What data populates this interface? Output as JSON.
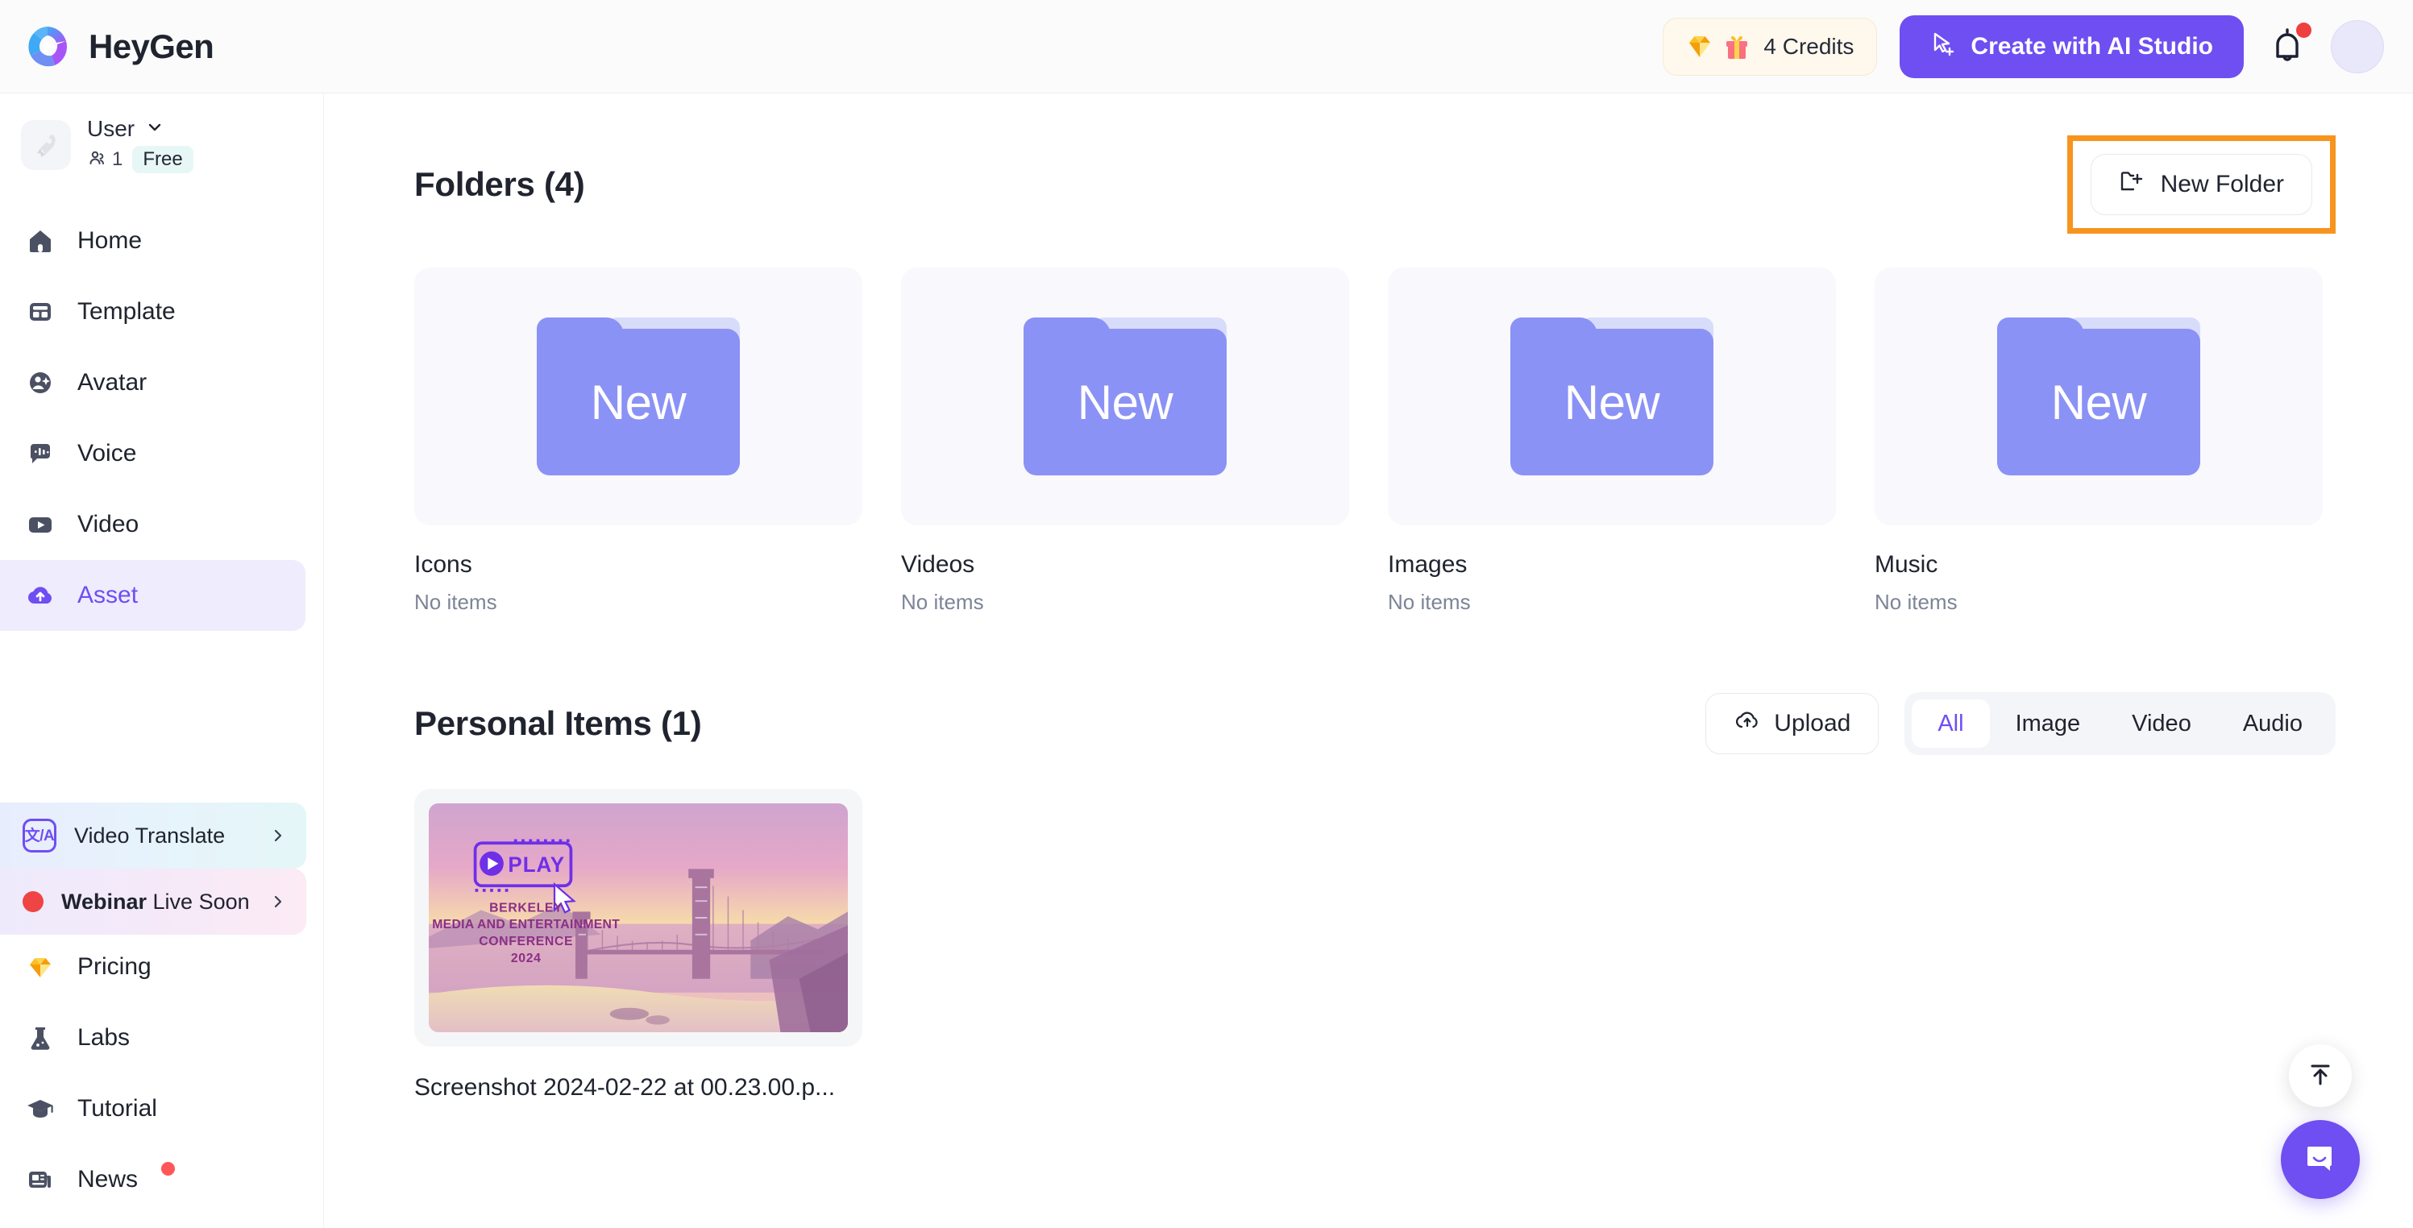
{
  "brand": {
    "name": "HeyGen",
    "logo_icon": "heygen-logo-icon"
  },
  "topbar": {
    "credits": {
      "label": "4 Credits",
      "gem_icon": "gem-icon",
      "gift_icon": "gift-icon"
    },
    "cta": {
      "label": "Create with AI Studio",
      "icon": "cursor-plus-icon"
    },
    "bell_icon": "bell-icon",
    "avatar_icon": "avatar-icon"
  },
  "sidebar": {
    "workspace": {
      "name": "User",
      "seats": "1",
      "plan": "Free",
      "thumb_icon": "rocket-icon",
      "chevron_icon": "chevron-down-icon",
      "members_icon": "members-icon"
    },
    "items": [
      {
        "label": "Home",
        "icon": "home-icon",
        "active": false
      },
      {
        "label": "Template",
        "icon": "template-icon",
        "active": false
      },
      {
        "label": "Avatar",
        "icon": "avatar-face-icon",
        "active": false
      },
      {
        "label": "Voice",
        "icon": "voice-icon",
        "active": false
      },
      {
        "label": "Video",
        "icon": "video-icon",
        "active": false
      },
      {
        "label": "Asset",
        "icon": "asset-cloud-icon",
        "active": true
      }
    ],
    "promos": [
      {
        "label": "Video Translate",
        "badge": "文/A",
        "icon": "translate-badge-icon",
        "chevron": "chevron-right-icon"
      },
      {
        "label_bold": "Webinar",
        "label_rest": " Live Soon",
        "icon": "live-dot-icon",
        "chevron": "chevron-right-icon"
      }
    ],
    "bottom_items": [
      {
        "label": "Pricing",
        "icon": "gem-icon",
        "dot": false
      },
      {
        "label": "Labs",
        "icon": "flask-icon",
        "dot": false
      },
      {
        "label": "Tutorial",
        "icon": "graduation-cap-icon",
        "dot": false
      },
      {
        "label": "News",
        "icon": "news-icon",
        "dot": true
      }
    ]
  },
  "main": {
    "folders_section": {
      "title": "Folders (4)",
      "new_folder_label": "New Folder",
      "new_folder_icon": "folder-plus-icon",
      "highlight_color": "#f7941e",
      "folders": [
        {
          "name": "Icons",
          "sub": "No items",
          "badge": "New"
        },
        {
          "name": "Videos",
          "sub": "No items",
          "badge": "New"
        },
        {
          "name": "Images",
          "sub": "No items",
          "badge": "New"
        },
        {
          "name": "Music",
          "sub": "No items",
          "badge": "New"
        }
      ]
    },
    "personal_section": {
      "title": "Personal Items (1)",
      "upload_label": "Upload",
      "upload_icon": "upload-cloud-icon",
      "filters": [
        {
          "label": "All",
          "active": true
        },
        {
          "label": "Image",
          "active": false
        },
        {
          "label": "Video",
          "active": false
        },
        {
          "label": "Audio",
          "active": false
        }
      ],
      "assets": [
        {
          "name": "Screenshot 2024-02-22 at 00.23.00.p...",
          "thumb": {
            "play_badge": "PLAY",
            "line1": "BERKELEY",
            "line2": "MEDIA AND ENTERTAINMENT",
            "line3": "CONFERENCE",
            "line4": "2024"
          }
        }
      ]
    }
  },
  "floating": {
    "scroll_top_icon": "arrow-up-to-line-icon",
    "chat_icon": "chat-bubble-icon"
  },
  "colors": {
    "accent": "#6f4ef2",
    "folder": "#8b92f5",
    "highlight": "#f7941e",
    "danger": "#ef4444"
  }
}
